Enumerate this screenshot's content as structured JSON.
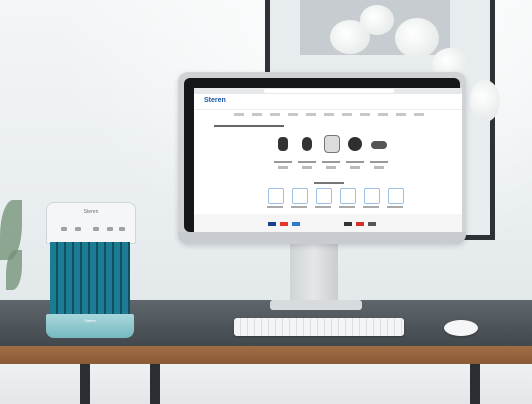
{
  "scene": {
    "description_items": [
      "monitor",
      "keyboard",
      "mouse",
      "air-cooler",
      "desk",
      "flowers",
      "picture-frame"
    ]
  },
  "monitor_screen": {
    "site_logo": "Steren"
  },
  "air_cooler": {
    "brand": "Steren"
  },
  "colors": {
    "desk_top": "#4f565b",
    "desk_edge": "#9a6641",
    "cooler_grille": "#0f5b6e",
    "cooler_tank": "#8fc7ce",
    "site_brand": "#1b57a6"
  }
}
